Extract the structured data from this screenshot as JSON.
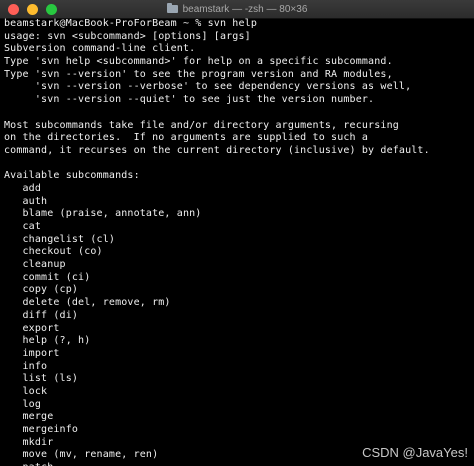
{
  "window": {
    "title": "beamstark — -zsh — 80×36"
  },
  "terminal": {
    "lines": [
      "beamstark@MacBook-ProForBeam ~ % svn help",
      "usage: svn <subcommand> [options] [args]",
      "Subversion command-line client.",
      "Type 'svn help <subcommand>' for help on a specific subcommand.",
      "Type 'svn --version' to see the program version and RA modules,",
      "     'svn --version --verbose' to see dependency versions as well,",
      "     'svn --version --quiet' to see just the version number.",
      "",
      "Most subcommands take file and/or directory arguments, recursing",
      "on the directories.  If no arguments are supplied to such a",
      "command, it recurses on the current directory (inclusive) by default.",
      "",
      "Available subcommands:",
      "   add",
      "   auth",
      "   blame (praise, annotate, ann)",
      "   cat",
      "   changelist (cl)",
      "   checkout (co)",
      "   cleanup",
      "   commit (ci)",
      "   copy (cp)",
      "   delete (del, remove, rm)",
      "   diff (di)",
      "   export",
      "   help (?, h)",
      "   import",
      "   info",
      "   list (ls)",
      "   lock",
      "   log",
      "   merge",
      "   mergeinfo",
      "   mkdir",
      "   move (mv, rename, ren)",
      "   patch"
    ]
  },
  "watermark": "CSDN @JavaYes!",
  "colors": {
    "background": "#000000",
    "text": "#f0f0f0",
    "titlebar": "#2c2c2c",
    "close": "#ff5f57",
    "minimize": "#febc2e",
    "zoom": "#28c840"
  }
}
